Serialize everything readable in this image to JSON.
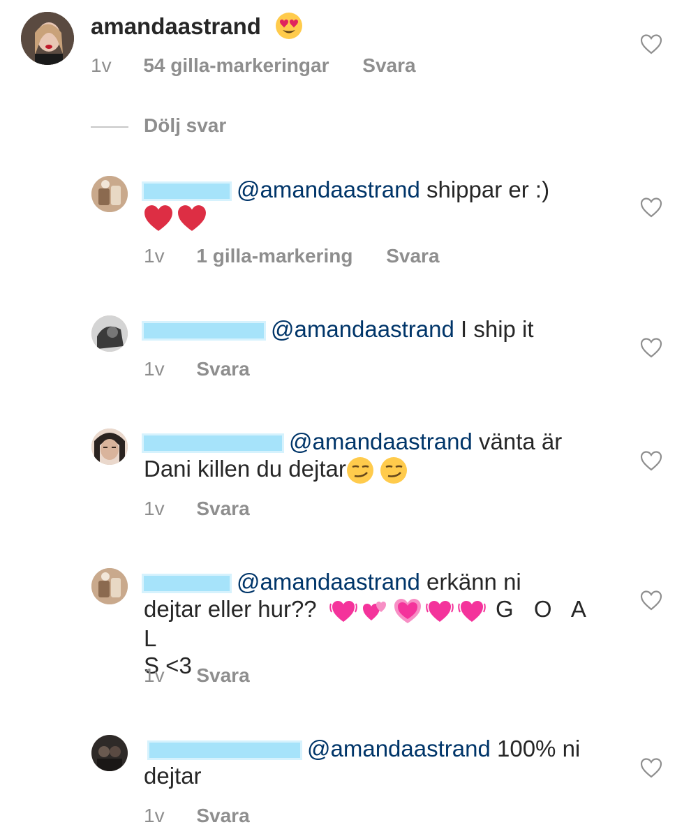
{
  "main_comment": {
    "username": "amandaastrand",
    "emoji": "heart-eyes",
    "time": "1v",
    "likes": "54 gilla-markeringar",
    "reply": "Svara"
  },
  "hide_replies": "Dölj svar",
  "replies": [
    {
      "mention": "@amandaastrand",
      "text": "shippar er :)",
      "emojis": [
        "red-heart",
        "red-heart"
      ],
      "time": "1v",
      "likes": "1 gilla-markering",
      "reply": "Svara"
    },
    {
      "mention": "@amandaastrand",
      "text": "I ship it",
      "time": "1v",
      "reply": "Svara"
    },
    {
      "mention": "@amandaastrand",
      "text_line1": "vänta är",
      "text_line2": "Dani killen du dejtar",
      "emojis": [
        "smirking-face",
        "smirking-face"
      ],
      "time": "1v",
      "reply": "Svara"
    },
    {
      "mention": "@amandaastrand",
      "text_line1": "erkänn ni",
      "text_line2": "dejtar eller hur??",
      "emojis": [
        "beating-heart",
        "revolving-hearts",
        "growing-heart",
        "beating-heart",
        "beating-heart"
      ],
      "goal_line": "G O A L",
      "goal_end": "S <3",
      "time": "1v",
      "reply": "Svara"
    },
    {
      "mention": "@amandaastrand",
      "text_line1": "100% ni",
      "text_line2": "dejtar",
      "time": "1v",
      "reply": "Svara"
    }
  ],
  "colors": {
    "mention": "#003569",
    "meta": "#8e8e8e",
    "redaction": "#a6e3fa"
  }
}
